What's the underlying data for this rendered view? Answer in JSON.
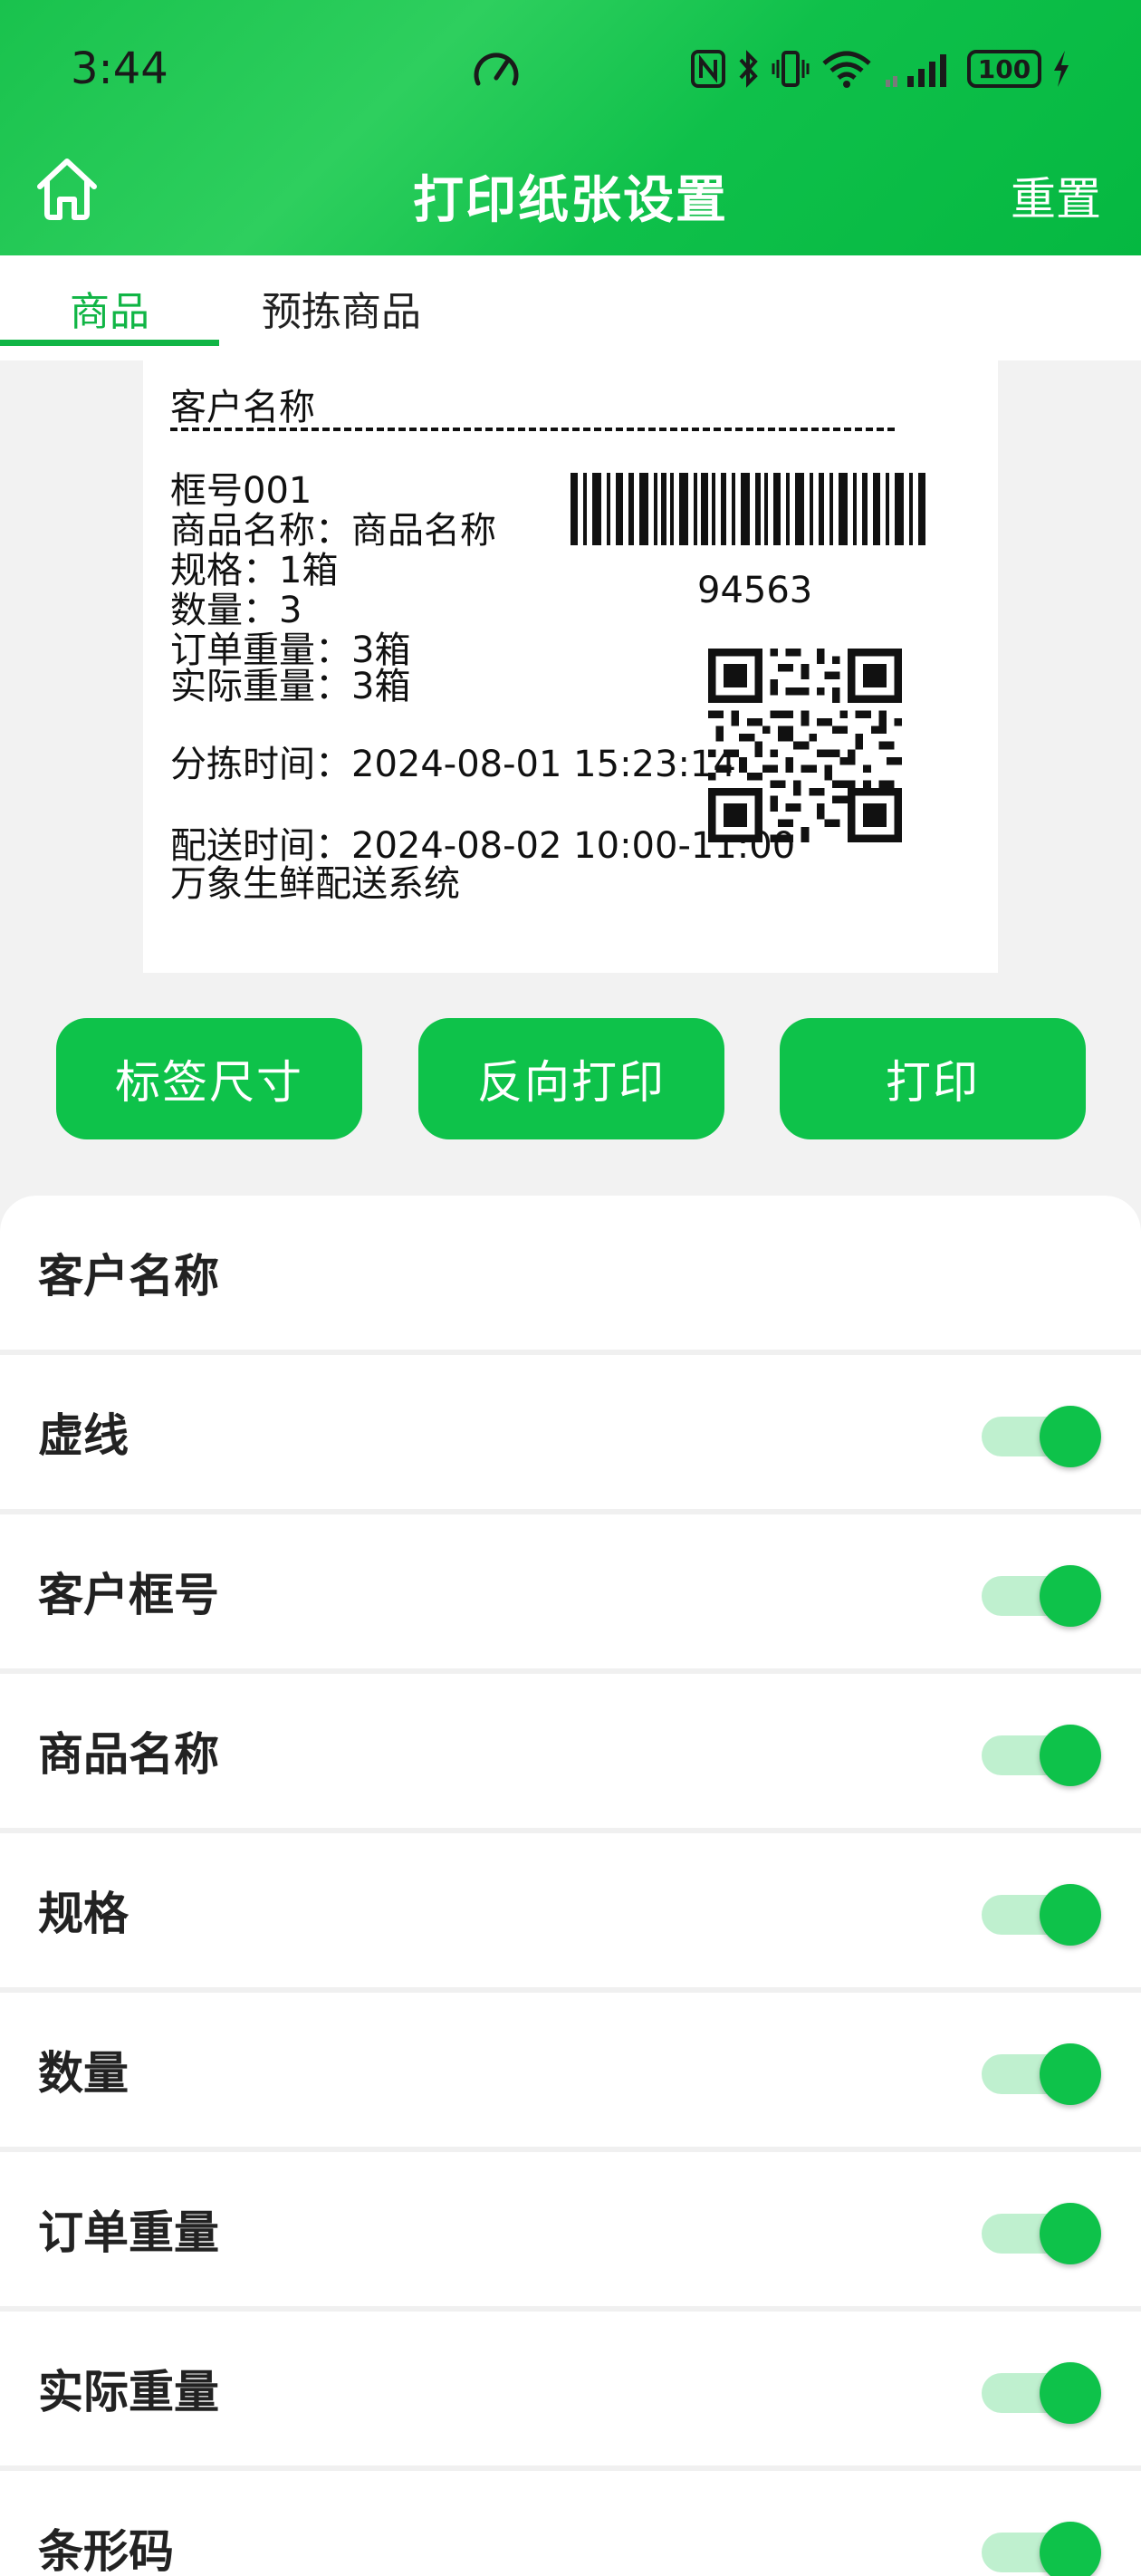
{
  "status_bar": {
    "time": "3:44",
    "battery": "100",
    "icons": [
      "speedometer-icon",
      "nfc-icon",
      "bluetooth-icon",
      "vibrate-icon",
      "wifi-icon",
      "signal-icon",
      "battery-icon",
      "charging-icon"
    ]
  },
  "app_bar": {
    "title": "打印纸张设置",
    "reset_label": "重置",
    "home_icon": "home-icon"
  },
  "tabs": [
    {
      "label": "商品",
      "active": true
    },
    {
      "label": "预拣商品",
      "active": false
    }
  ],
  "preview": {
    "customer_name": "客户名称",
    "frame_no": "框号001",
    "product_name": "商品名称：商品名称",
    "spec": "规格：1箱",
    "quantity": "数量：3",
    "order_weight": "订单重量：3箱",
    "actual_weight": "实际重量：3箱",
    "sort_time": "分拣时间：2024-08-01 15:23:14",
    "delivery_time": "配送时间：2024-08-02 10:00-11:00",
    "system_name": "万象生鲜配送系统",
    "barcode_number": "94563"
  },
  "buttons": {
    "label_size": "标签尺寸",
    "reverse_print": "反向打印",
    "print": "打印"
  },
  "settings": [
    {
      "label": "客户名称",
      "has_toggle": false
    },
    {
      "label": "虚线",
      "has_toggle": true,
      "on": true
    },
    {
      "label": "客户框号",
      "has_toggle": true,
      "on": true
    },
    {
      "label": "商品名称",
      "has_toggle": true,
      "on": true
    },
    {
      "label": "规格",
      "has_toggle": true,
      "on": true
    },
    {
      "label": "数量",
      "has_toggle": true,
      "on": true
    },
    {
      "label": "订单重量",
      "has_toggle": true,
      "on": true
    },
    {
      "label": "实际重量",
      "has_toggle": true,
      "on": true
    },
    {
      "label": "条形码",
      "has_toggle": true,
      "on": true
    }
  ],
  "colors": {
    "brand_green": "#0ec24a",
    "toggle_track": "#bff0cf",
    "tab_active": "#10b545"
  }
}
